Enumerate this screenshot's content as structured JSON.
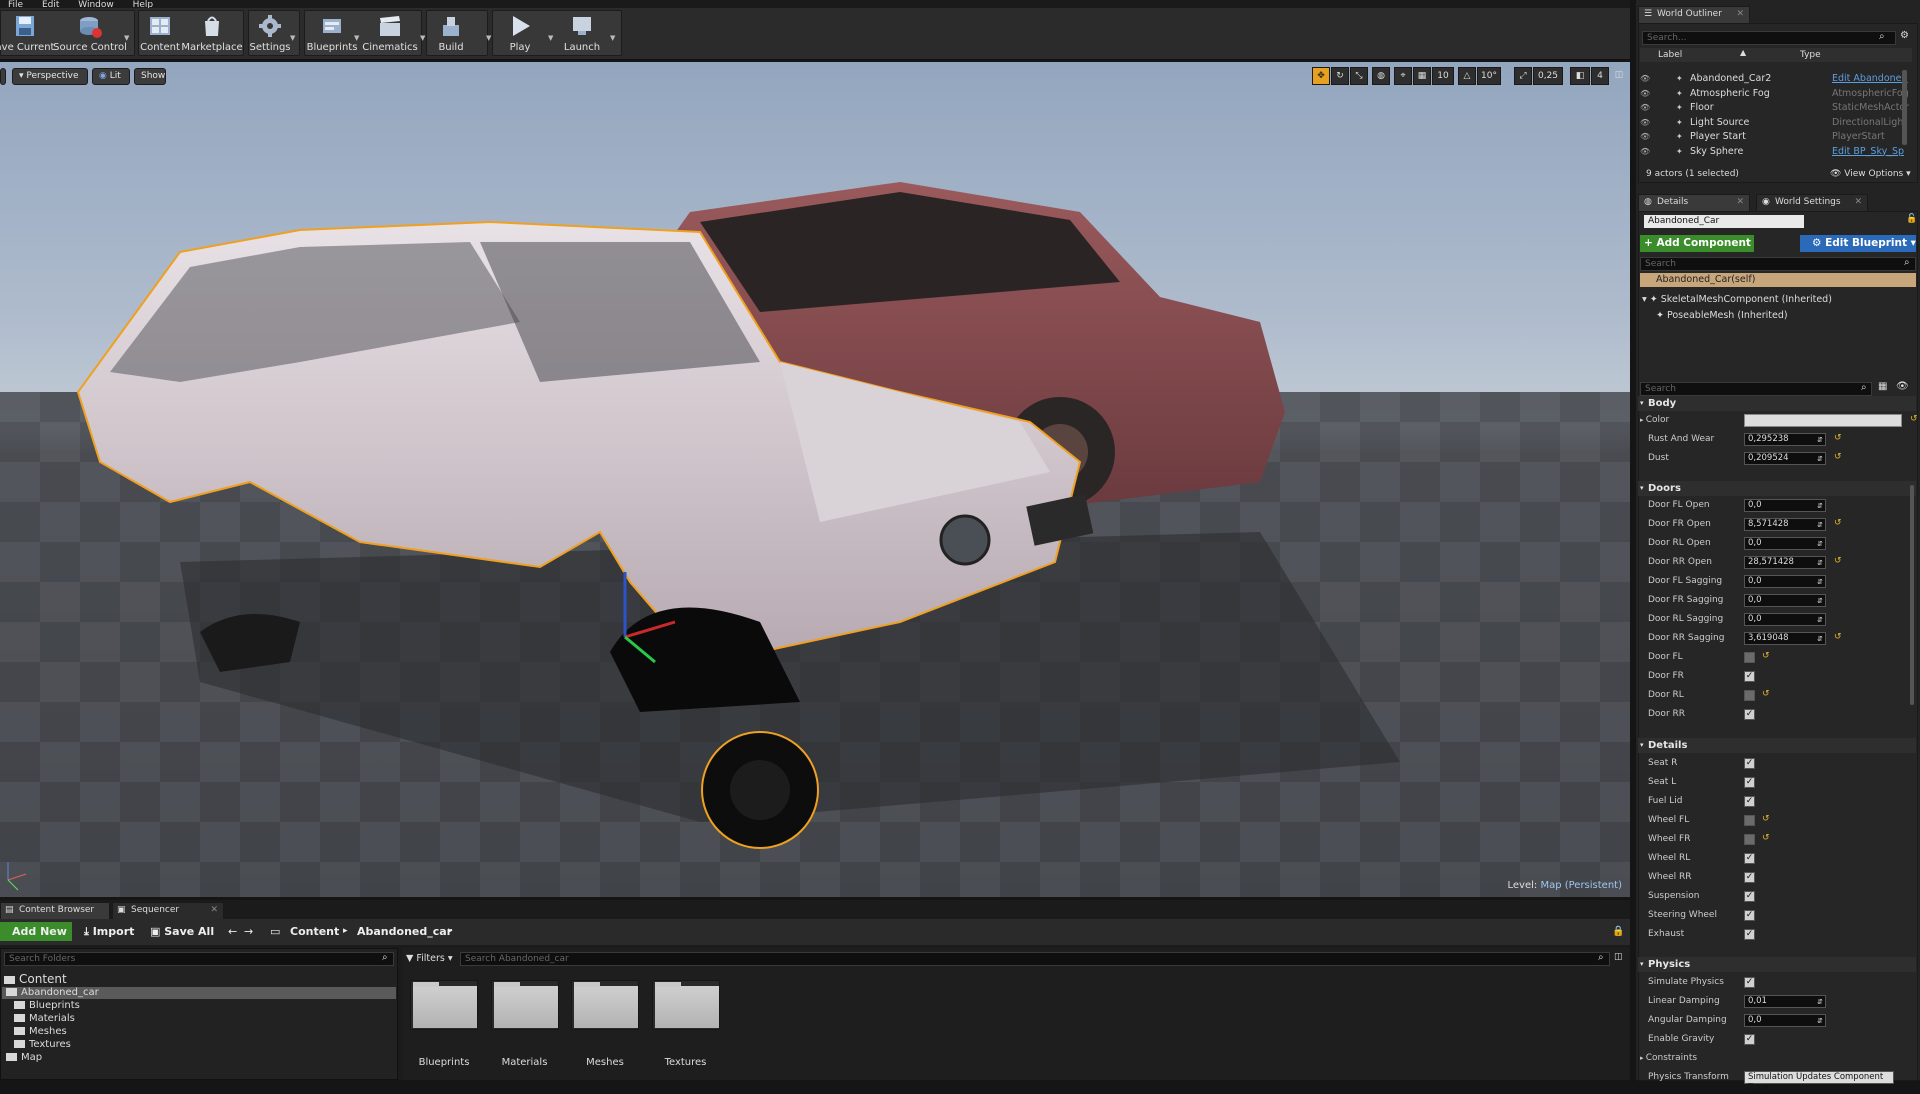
{
  "menu": [
    "File",
    "Edit",
    "Window",
    "Help"
  ],
  "toolbar": {
    "save_current": "ave Current",
    "source_control": "Source Control",
    "content": "Content",
    "marketplace": "Marketplace",
    "settings": "Settings",
    "blueprints": "Blueprints",
    "cinematics": "Cinematics",
    "build": "Build",
    "play": "Play",
    "launch": "Launch"
  },
  "viewport": {
    "perspective": "Perspective",
    "lit": "Lit",
    "show": "Show",
    "grid_snap": "10",
    "rot_snap": "10°",
    "scale_snap": "0,25",
    "camera_speed": "4",
    "level_label": "Level:",
    "level_value": "Map (Persistent)"
  },
  "outliner": {
    "tab": "World Outliner",
    "search_placeholder": "Search...",
    "col_label": "Label",
    "col_type": "Type",
    "rows": [
      {
        "name": "Abandoned_Car2",
        "type": "Edit Abandoned",
        "link": true
      },
      {
        "name": "Atmospheric Fog",
        "type": "AtmosphericFog",
        "link": false
      },
      {
        "name": "Floor",
        "type": "StaticMeshActor",
        "link": false
      },
      {
        "name": "Light Source",
        "type": "DirectionalLight",
        "link": false
      },
      {
        "name": "Player Start",
        "type": "PlayerStart",
        "link": false
      },
      {
        "name": "Sky Sphere",
        "type": "Edit BP_Sky_Sp",
        "link": true
      }
    ],
    "footer": "9 actors (1 selected)",
    "view_options": "View Options"
  },
  "details": {
    "tab": "Details",
    "tab2": "World Settings",
    "actor_name": "Abandoned_Car",
    "add_component": "+ Add Component",
    "edit_blueprint": "Edit Blueprint",
    "search_placeholder": "Search",
    "self_row": "Abandoned_Car(self)",
    "comp1": "SkeletalMeshComponent (Inherited)",
    "comp2": "PoseableMesh (Inherited)",
    "search2_placeholder": "Search",
    "body": {
      "title": "Body",
      "color": "Color",
      "rust_label": "Rust And Wear",
      "rust_value": "0,295238",
      "dust_label": "Dust",
      "dust_value": "0,209524"
    },
    "doors": {
      "title": "Doors",
      "fields": [
        {
          "label": "Door FL Open",
          "value": "0,0",
          "reset": false
        },
        {
          "label": "Door FR Open",
          "value": "8,571428",
          "reset": true
        },
        {
          "label": "Door RL Open",
          "value": "0,0",
          "reset": false
        },
        {
          "label": "Door RR Open",
          "value": "28,571428",
          "reset": true
        },
        {
          "label": "Door FL Sagging",
          "value": "0,0",
          "reset": false
        },
        {
          "label": "Door FR Sagging",
          "value": "0,0",
          "reset": false
        },
        {
          "label": "Door RL Sagging",
          "value": "0,0",
          "reset": false
        },
        {
          "label": "Door RR Sagging",
          "value": "3,619048",
          "reset": true
        }
      ],
      "checks": [
        {
          "label": "Door FL",
          "checked": false,
          "reset": true
        },
        {
          "label": "Door FR",
          "checked": true,
          "reset": false
        },
        {
          "label": "Door RL",
          "checked": false,
          "reset": true
        },
        {
          "label": "Door RR",
          "checked": true,
          "reset": false
        }
      ]
    },
    "details_sect": {
      "title": "Details",
      "checks": [
        {
          "label": "Seat R",
          "checked": true,
          "reset": false
        },
        {
          "label": "Seat L",
          "checked": true,
          "reset": false
        },
        {
          "label": "Fuel Lid",
          "checked": true,
          "reset": false
        },
        {
          "label": "Wheel FL",
          "checked": false,
          "reset": true
        },
        {
          "label": "Wheel FR",
          "checked": false,
          "reset": true
        },
        {
          "label": "Wheel RL",
          "checked": true,
          "reset": false
        },
        {
          "label": "Wheel RR",
          "checked": true,
          "reset": false
        },
        {
          "label": "Suspension",
          "checked": true,
          "reset": false
        },
        {
          "label": "Steering Wheel",
          "checked": true,
          "reset": false
        },
        {
          "label": "Exhaust",
          "checked": true,
          "reset": false
        }
      ]
    },
    "physics": {
      "title": "Physics",
      "simulate": "Simulate Physics",
      "linear_label": "Linear Damping",
      "linear_value": "0,01",
      "angular_label": "Angular Damping",
      "angular_value": "0,0",
      "gravity": "Enable Gravity",
      "constraints": "Constraints",
      "transform_label": "Physics Transform",
      "transform_value": "Simulation Updates Component Tra"
    }
  },
  "content_browser": {
    "tab": "Content Browser",
    "tab2": "Sequencer",
    "add_new": "Add New",
    "import": "Import",
    "save_all": "Save All",
    "path1": "Content",
    "path2": "Abandoned_car",
    "search_folders": "Search Folders",
    "filters": "Filters",
    "search_assets": "Search Abandoned_car",
    "tree": {
      "root": "Content",
      "child": "Abandoned_car",
      "items": [
        "Blueprints",
        "Materials",
        "Meshes",
        "Textures"
      ],
      "map": "Map"
    },
    "assets": [
      "Blueprints",
      "Materials",
      "Meshes",
      "Textures"
    ]
  },
  "colors": {
    "selection_outline": "#f0a020",
    "add_component": "#3a8d2a",
    "edit_blueprint": "#2a6ab8",
    "selected_row": "#c8a67c"
  }
}
